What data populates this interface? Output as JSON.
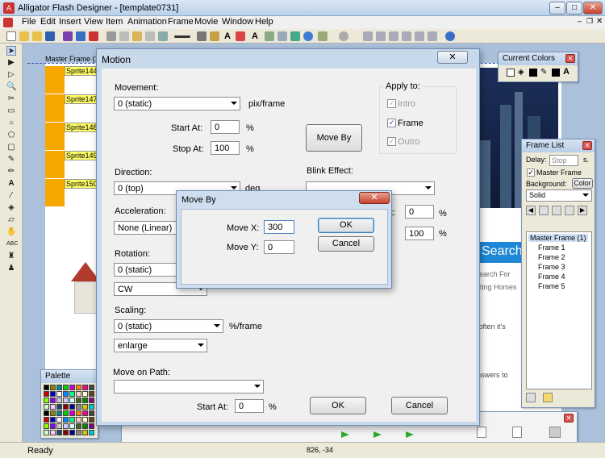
{
  "app": {
    "title": "Alligator Flash Designer - [template0731]"
  },
  "menu": [
    "File",
    "Edit",
    "Insert",
    "View",
    "Item",
    "Animation",
    "Frame",
    "Movie",
    "Window",
    "Help"
  ],
  "canvas": {
    "master_frame_label": "Master Frame (1)",
    "sprites": [
      "Sprite144",
      "Sprite147",
      "Sprite148",
      "Sprite149",
      "Sprite150"
    ],
    "search_label": "Search",
    "search_for": "Search For",
    "existing": "xisting Homes",
    "often": "o often it's",
    "answers": "answers to"
  },
  "current_colors": {
    "title": "Current Colors"
  },
  "frame_list": {
    "title": "Frame List",
    "delay_label": "Delay:",
    "delay_value": "Stop",
    "delay_unit": "s.",
    "master_frame_check": "Master Frame",
    "background_label": "Background:",
    "color_button": "Color",
    "fill_value": "Solid",
    "frames": [
      "Master Frame (1)",
      "Frame 1",
      "Frame 2",
      "Frame 3",
      "Frame 4",
      "Frame 5"
    ]
  },
  "palette": {
    "title": "Palette"
  },
  "motion": {
    "title": "Motion",
    "movement_label": "Movement:",
    "movement_value": "0 (static)",
    "movement_unit": "pix/frame",
    "start_at_label": "Start At:",
    "start_at_value": "0",
    "stop_at_label": "Stop At:",
    "stop_at_value": "100",
    "percent": "%",
    "move_by_button": "Move By",
    "apply_to_label": "Apply to:",
    "intro": "Intro",
    "frame": "Frame",
    "outro": "Outro",
    "direction_label": "Direction:",
    "direction_value": "0 (top)",
    "direction_unit": "deg",
    "blink_label": "Blink Effect:",
    "acceleration_label": "Acceleration:",
    "acceleration_value": "None (Linear)",
    "blink_start_suffix": "t:",
    "blink_start_value": "0",
    "blink_stop_value": "100",
    "rotation_label": "Rotation:",
    "rotation_value": "0 (static)",
    "rotation_dir": "CW",
    "scaling_label": "Scaling:",
    "scaling_value": "0 (static)",
    "scaling_unit": "%/frame",
    "scaling_mode": "enlarge",
    "path_label": "Move on Path:",
    "path_value": "",
    "path_start_label": "Start At:",
    "path_start_value": "0",
    "ok": "OK",
    "cancel": "Cancel"
  },
  "moveby": {
    "title": "Move By",
    "x_label": "Move X:",
    "x_value": "300",
    "y_label": "Move Y:",
    "y_value": "0",
    "ok": "OK",
    "cancel": "Cancel"
  },
  "status": {
    "text": "Ready",
    "coords": "826, -34"
  }
}
